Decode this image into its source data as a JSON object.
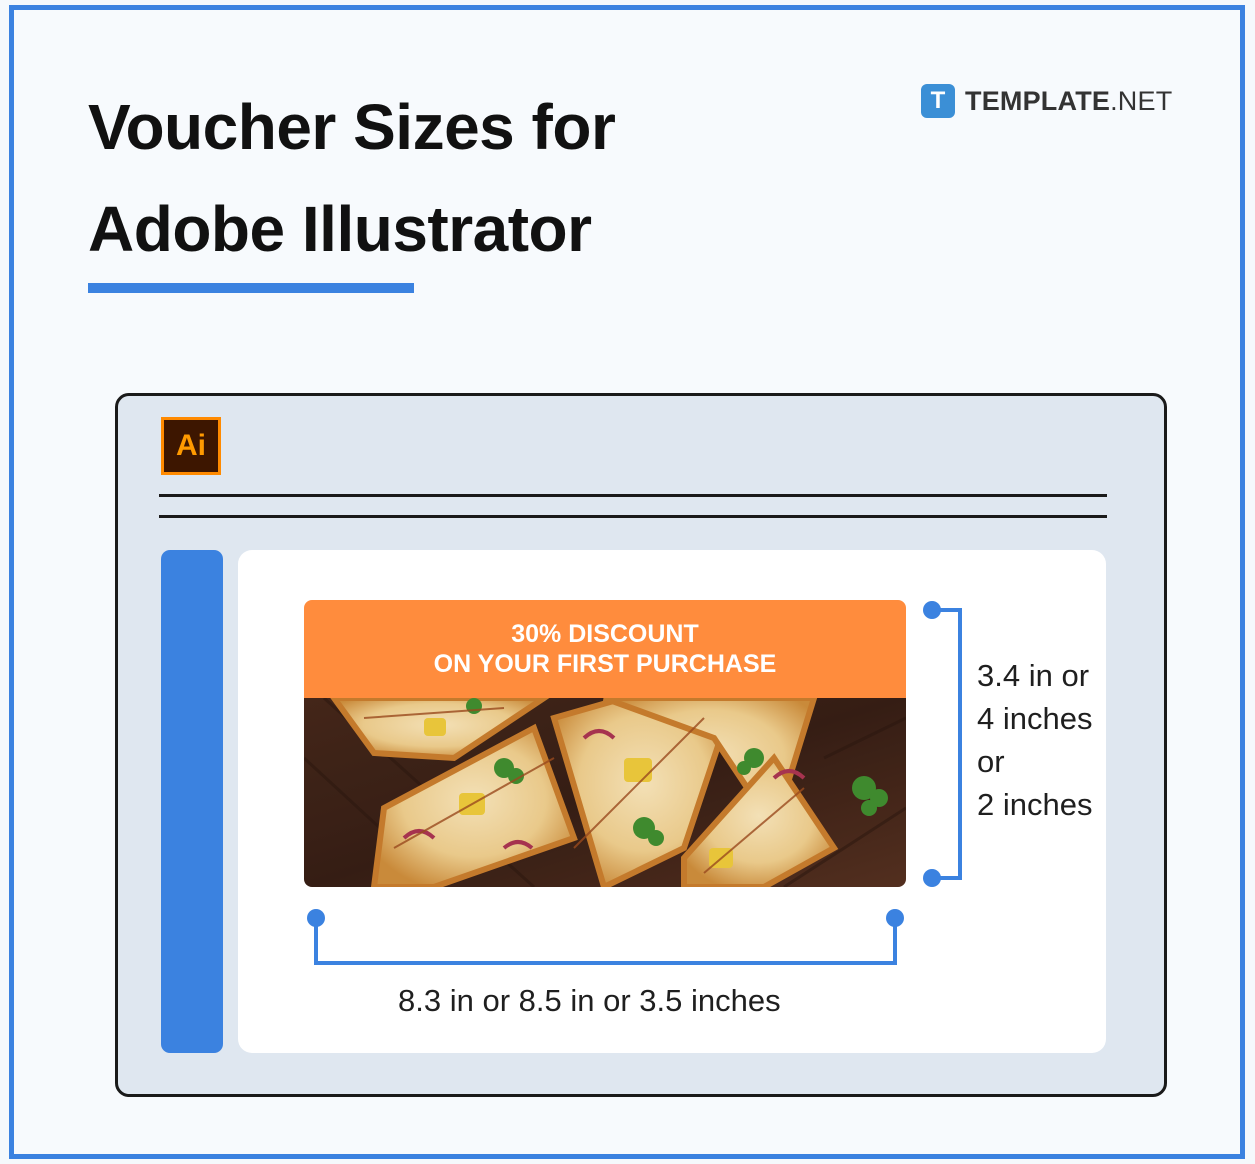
{
  "header": {
    "title_line1": "Voucher Sizes for",
    "title_line2": "Adobe Illustrator"
  },
  "brand": {
    "icon_letter": "T",
    "name_bold": "TEMPLATE",
    "name_suffix": ".NET"
  },
  "app": {
    "logo_text": "Ai",
    "logo_bg": "#3d1600",
    "logo_accent": "#ff8a00"
  },
  "voucher": {
    "line1": "30% DISCOUNT",
    "line2": "ON YOUR FIRST PURCHASE",
    "banner_color": "#ff8c3d"
  },
  "dimensions": {
    "height_lines": [
      "3.4 in or",
      "4 inches",
      "or",
      "2 inches"
    ],
    "width_label": "8.3 in or 8.5 in or 3.5 inches"
  },
  "colors": {
    "accent": "#3b82e0",
    "window_bg": "#dfe7f0"
  }
}
